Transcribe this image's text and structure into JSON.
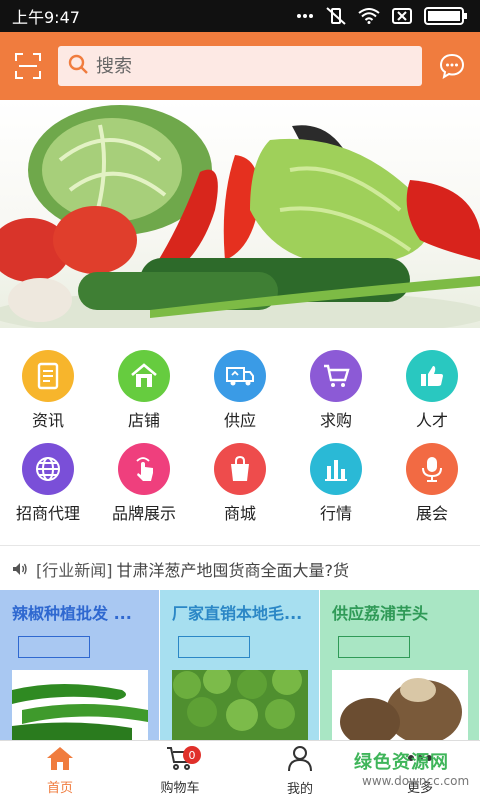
{
  "status_bar": {
    "time": "上午9:47"
  },
  "header": {
    "search_placeholder": "搜索"
  },
  "grid": [
    {
      "label": "资讯",
      "color": "#f7b52c",
      "icon": "document-icon"
    },
    {
      "label": "店铺",
      "color": "#66cc3f",
      "icon": "shop-icon"
    },
    {
      "label": "供应",
      "color": "#3a9be6",
      "icon": "truck-icon"
    },
    {
      "label": "求购",
      "color": "#8c5ad6",
      "icon": "cart-icon"
    },
    {
      "label": "人才",
      "color": "#29c8c0",
      "icon": "thumbs-up-icon"
    },
    {
      "label": "招商代理",
      "color": "#7a4fd8",
      "icon": "globe-icon"
    },
    {
      "label": "品牌展示",
      "color": "#ef3f7d",
      "icon": "tap-icon"
    },
    {
      "label": "商城",
      "color": "#ee4c4c",
      "icon": "bag-icon"
    },
    {
      "label": "行情",
      "color": "#2ab9d6",
      "icon": "bar-chart-icon"
    },
    {
      "label": "展会",
      "color": "#f26a43",
      "icon": "microphone-icon"
    }
  ],
  "news": {
    "tag": "[行业新闻]",
    "text": "甘肃洋葱产地囤货商全面大量?货"
  },
  "cards": [
    {
      "title": "辣椒种植批发 ...",
      "title_color": "#2f68d0",
      "bg": "#a9c8f2",
      "btn_border": "#2f68d0"
    },
    {
      "title": "厂家直销本地毛...",
      "title_color": "#2b87c6",
      "bg": "#a7dff0",
      "btn_border": "#2b87c6"
    },
    {
      "title": "供应荔浦芋头",
      "title_color": "#2f9a57",
      "bg": "#a9e6c4",
      "btn_border": "#2f9a57"
    }
  ],
  "bottom_nav": [
    {
      "label": "首页",
      "active": true
    },
    {
      "label": "购物车",
      "badge": "0"
    },
    {
      "label": "我的"
    },
    {
      "label": "更多"
    }
  ],
  "watermark": {
    "main": "绿色资源网",
    "sub": "www.downcc.com"
  },
  "colors": {
    "accent": "#f07c3e"
  }
}
